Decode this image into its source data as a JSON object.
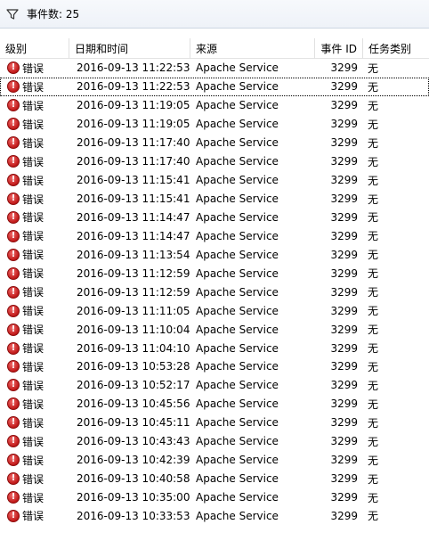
{
  "toolbar": {
    "filter_icon": "filter-funnel-icon",
    "event_count_label": "事件数: 25"
  },
  "columns": {
    "level": "级别",
    "datetime": "日期和时间",
    "source": "来源",
    "event_id": "事件 ID",
    "task_category": "任务类别"
  },
  "error_icon_glyph": "!",
  "rows": [
    {
      "level": "错误",
      "datetime": "2016-09-13 11:22:53",
      "source": "Apache Service",
      "event_id": "3299",
      "category": "无"
    },
    {
      "level": "错误",
      "datetime": "2016-09-13 11:22:53",
      "source": "Apache Service",
      "event_id": "3299",
      "category": "无"
    },
    {
      "level": "错误",
      "datetime": "2016-09-13 11:19:05",
      "source": "Apache Service",
      "event_id": "3299",
      "category": "无"
    },
    {
      "level": "错误",
      "datetime": "2016-09-13 11:19:05",
      "source": "Apache Service",
      "event_id": "3299",
      "category": "无"
    },
    {
      "level": "错误",
      "datetime": "2016-09-13 11:17:40",
      "source": "Apache Service",
      "event_id": "3299",
      "category": "无"
    },
    {
      "level": "错误",
      "datetime": "2016-09-13 11:17:40",
      "source": "Apache Service",
      "event_id": "3299",
      "category": "无"
    },
    {
      "level": "错误",
      "datetime": "2016-09-13 11:15:41",
      "source": "Apache Service",
      "event_id": "3299",
      "category": "无"
    },
    {
      "level": "错误",
      "datetime": "2016-09-13 11:15:41",
      "source": "Apache Service",
      "event_id": "3299",
      "category": "无"
    },
    {
      "level": "错误",
      "datetime": "2016-09-13 11:14:47",
      "source": "Apache Service",
      "event_id": "3299",
      "category": "无"
    },
    {
      "level": "错误",
      "datetime": "2016-09-13 11:14:47",
      "source": "Apache Service",
      "event_id": "3299",
      "category": "无"
    },
    {
      "level": "错误",
      "datetime": "2016-09-13 11:13:54",
      "source": "Apache Service",
      "event_id": "3299",
      "category": "无"
    },
    {
      "level": "错误",
      "datetime": "2016-09-13 11:12:59",
      "source": "Apache Service",
      "event_id": "3299",
      "category": "无"
    },
    {
      "level": "错误",
      "datetime": "2016-09-13 11:12:59",
      "source": "Apache Service",
      "event_id": "3299",
      "category": "无"
    },
    {
      "level": "错误",
      "datetime": "2016-09-13 11:11:05",
      "source": "Apache Service",
      "event_id": "3299",
      "category": "无"
    },
    {
      "level": "错误",
      "datetime": "2016-09-13 11:10:04",
      "source": "Apache Service",
      "event_id": "3299",
      "category": "无"
    },
    {
      "level": "错误",
      "datetime": "2016-09-13 11:04:10",
      "source": "Apache Service",
      "event_id": "3299",
      "category": "无"
    },
    {
      "level": "错误",
      "datetime": "2016-09-13 10:53:28",
      "source": "Apache Service",
      "event_id": "3299",
      "category": "无"
    },
    {
      "level": "错误",
      "datetime": "2016-09-13 10:52:17",
      "source": "Apache Service",
      "event_id": "3299",
      "category": "无"
    },
    {
      "level": "错误",
      "datetime": "2016-09-13 10:45:56",
      "source": "Apache Service",
      "event_id": "3299",
      "category": "无"
    },
    {
      "level": "错误",
      "datetime": "2016-09-13 10:45:11",
      "source": "Apache Service",
      "event_id": "3299",
      "category": "无"
    },
    {
      "level": "错误",
      "datetime": "2016-09-13 10:43:43",
      "source": "Apache Service",
      "event_id": "3299",
      "category": "无"
    },
    {
      "level": "错误",
      "datetime": "2016-09-13 10:42:39",
      "source": "Apache Service",
      "event_id": "3299",
      "category": "无"
    },
    {
      "level": "错误",
      "datetime": "2016-09-13 10:40:58",
      "source": "Apache Service",
      "event_id": "3299",
      "category": "无"
    },
    {
      "level": "错误",
      "datetime": "2016-09-13 10:35:00",
      "source": "Apache Service",
      "event_id": "3299",
      "category": "无"
    },
    {
      "level": "错误",
      "datetime": "2016-09-13 10:33:53",
      "source": "Apache Service",
      "event_id": "3299",
      "category": "无"
    }
  ],
  "selected_row": 1
}
